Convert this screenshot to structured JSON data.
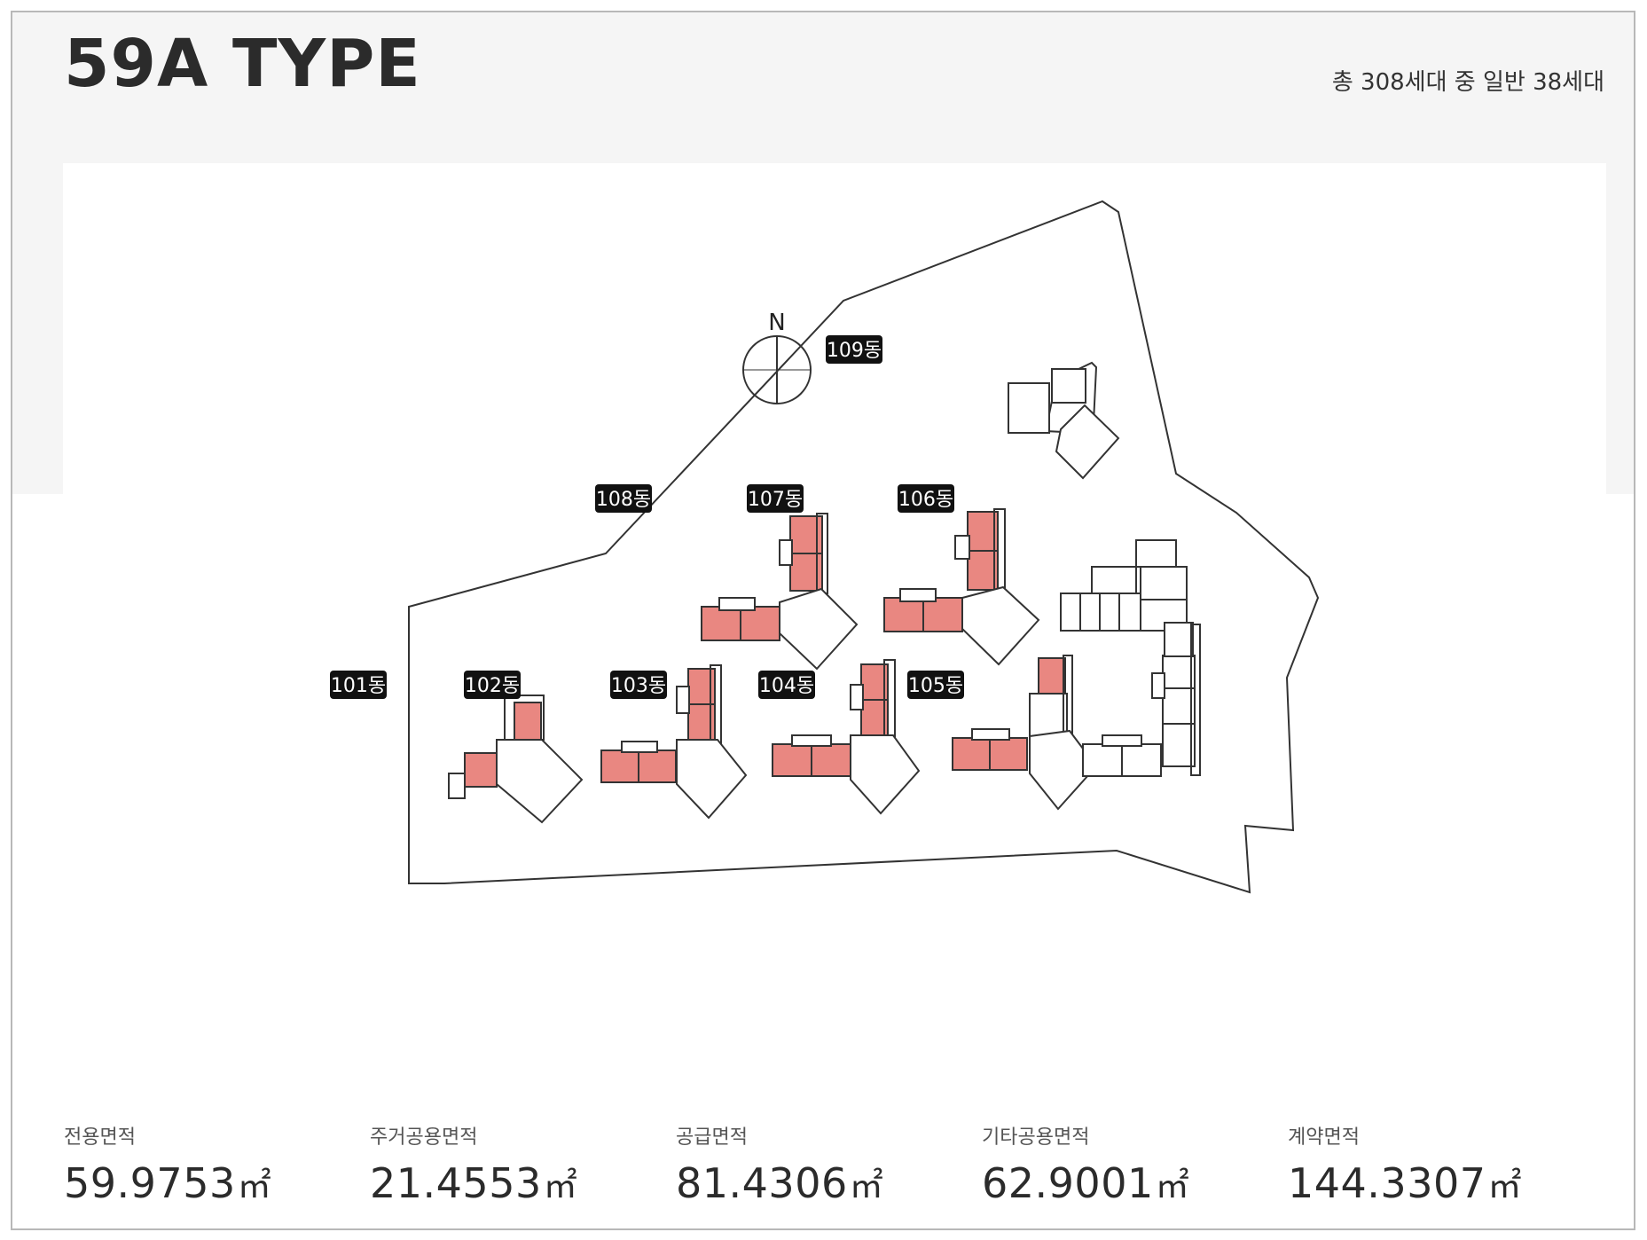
{
  "header": {
    "title": "59A TYPE",
    "summary": "총 308세대 중 일반 38세대"
  },
  "map": {
    "compass_letter": "N",
    "highlight_color": "#e98781",
    "buildings": [
      {
        "label": "101동"
      },
      {
        "label": "102동"
      },
      {
        "label": "103동"
      },
      {
        "label": "104동"
      },
      {
        "label": "105동"
      },
      {
        "label": "106동"
      },
      {
        "label": "107동"
      },
      {
        "label": "108동"
      },
      {
        "label": "109동"
      }
    ]
  },
  "areas": [
    {
      "label": "전용면적",
      "value": "59.9753",
      "unit": "㎡"
    },
    {
      "label": "주거공용면적",
      "value": "21.4553",
      "unit": "㎡"
    },
    {
      "label": "공급면적",
      "value": "81.4306",
      "unit": "㎡"
    },
    {
      "label": "기타공용면적",
      "value": "62.9001",
      "unit": "㎡"
    },
    {
      "label": "계약면적",
      "value": "144.3307",
      "unit": "㎡"
    }
  ]
}
